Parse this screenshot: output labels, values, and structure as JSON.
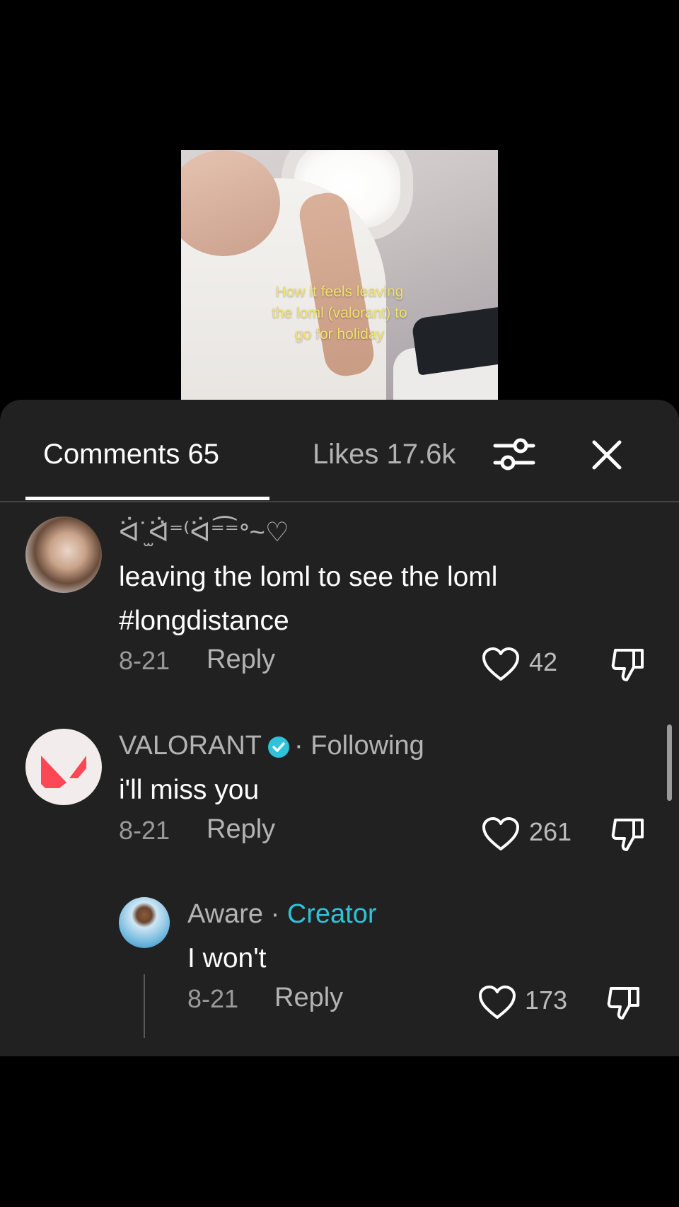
{
  "video": {
    "caption_lines": [
      "How it feels leaving",
      "the loml (valorant) to",
      "go for holiday"
    ]
  },
  "tabs": {
    "comments_label": "Comments 65",
    "likes_label": "Likes 17.6k"
  },
  "icons": {
    "filter": "sliders-icon",
    "close": "close-icon",
    "like": "heart-icon",
    "dislike": "thumbs-down-icon",
    "verified": "verified-check-icon"
  },
  "colors": {
    "sheet_bg": "#212121",
    "creator_accent": "#2fc2d8",
    "caption_yellow": "#f2e26b"
  },
  "comments": [
    {
      "username": "ᐛ˙̫ᐛ̇⁼⁽ᐛ⁼͡⁼ᐤ~♡",
      "text_line1": "leaving the loml to see the loml",
      "text_line2": "#longdistance",
      "date": "8-21",
      "reply": "Reply",
      "likes": "42"
    },
    {
      "username": "VALORANT",
      "following": "· Following",
      "text": "i'll miss you",
      "date": "8-21",
      "reply": "Reply",
      "likes": "261"
    },
    {
      "username": "Aware",
      "separator": " · ",
      "badge": "Creator",
      "text": "I won't",
      "date": "8-21",
      "reply": "Reply",
      "likes": "173"
    }
  ]
}
